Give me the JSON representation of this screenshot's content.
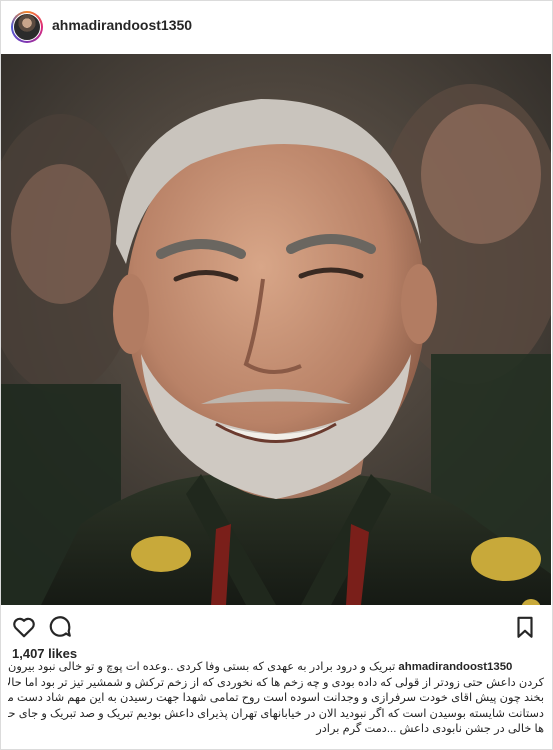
{
  "post": {
    "username": "ahmadirandoost1350",
    "likes": "1,407 likes",
    "photo_alt": "",
    "caption_user": "ahmadirandoost1350",
    "caption_lines": [
      "تبریک و درود برادر به عهدی که بستی وفا کردی ..وعده ات پوچ و تو خالی نبود بیرون",
      "کردن داعش حتی زودتر از قولی که داده بودی و چه زخم ها که نخوردی که از زخم ترکش و شمشیر تیز تر بود اما حالا",
      "بخند چون پیش اقای خودت سرفرازی و وجدانت اسوده است روح تمامی شهدا جهت رسیدن به این مهم شاد دست مریزاد",
      "دستانت شایسته بوسیدن است که اگر نبودید الان در خیابانهای تهران پذیرای داعش بودیم تبریک و صد تبریک و جای حججی",
      "ها خالی در جشن نابودی داعش ...دمت گرم برادر"
    ]
  },
  "icons": {
    "like": "heart-icon",
    "comment": "comment-icon",
    "save": "bookmark-icon"
  }
}
